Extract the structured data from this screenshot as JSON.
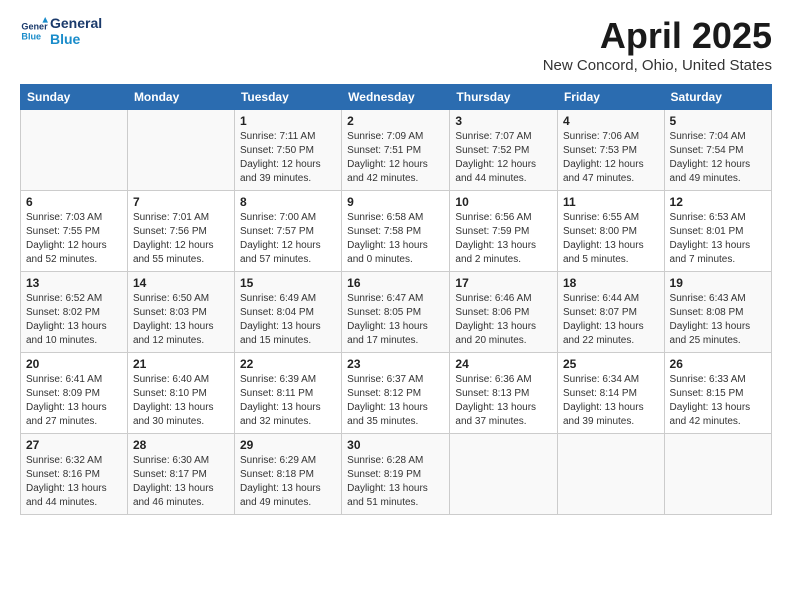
{
  "logo": {
    "line1": "General",
    "line2": "Blue"
  },
  "title": "April 2025",
  "location": "New Concord, Ohio, United States",
  "weekdays": [
    "Sunday",
    "Monday",
    "Tuesday",
    "Wednesday",
    "Thursday",
    "Friday",
    "Saturday"
  ],
  "weeks": [
    [
      {
        "day": "",
        "info": ""
      },
      {
        "day": "",
        "info": ""
      },
      {
        "day": "1",
        "info": "Sunrise: 7:11 AM\nSunset: 7:50 PM\nDaylight: 12 hours and 39 minutes."
      },
      {
        "day": "2",
        "info": "Sunrise: 7:09 AM\nSunset: 7:51 PM\nDaylight: 12 hours and 42 minutes."
      },
      {
        "day": "3",
        "info": "Sunrise: 7:07 AM\nSunset: 7:52 PM\nDaylight: 12 hours and 44 minutes."
      },
      {
        "day": "4",
        "info": "Sunrise: 7:06 AM\nSunset: 7:53 PM\nDaylight: 12 hours and 47 minutes."
      },
      {
        "day": "5",
        "info": "Sunrise: 7:04 AM\nSunset: 7:54 PM\nDaylight: 12 hours and 49 minutes."
      }
    ],
    [
      {
        "day": "6",
        "info": "Sunrise: 7:03 AM\nSunset: 7:55 PM\nDaylight: 12 hours and 52 minutes."
      },
      {
        "day": "7",
        "info": "Sunrise: 7:01 AM\nSunset: 7:56 PM\nDaylight: 12 hours and 55 minutes."
      },
      {
        "day": "8",
        "info": "Sunrise: 7:00 AM\nSunset: 7:57 PM\nDaylight: 12 hours and 57 minutes."
      },
      {
        "day": "9",
        "info": "Sunrise: 6:58 AM\nSunset: 7:58 PM\nDaylight: 13 hours and 0 minutes."
      },
      {
        "day": "10",
        "info": "Sunrise: 6:56 AM\nSunset: 7:59 PM\nDaylight: 13 hours and 2 minutes."
      },
      {
        "day": "11",
        "info": "Sunrise: 6:55 AM\nSunset: 8:00 PM\nDaylight: 13 hours and 5 minutes."
      },
      {
        "day": "12",
        "info": "Sunrise: 6:53 AM\nSunset: 8:01 PM\nDaylight: 13 hours and 7 minutes."
      }
    ],
    [
      {
        "day": "13",
        "info": "Sunrise: 6:52 AM\nSunset: 8:02 PM\nDaylight: 13 hours and 10 minutes."
      },
      {
        "day": "14",
        "info": "Sunrise: 6:50 AM\nSunset: 8:03 PM\nDaylight: 13 hours and 12 minutes."
      },
      {
        "day": "15",
        "info": "Sunrise: 6:49 AM\nSunset: 8:04 PM\nDaylight: 13 hours and 15 minutes."
      },
      {
        "day": "16",
        "info": "Sunrise: 6:47 AM\nSunset: 8:05 PM\nDaylight: 13 hours and 17 minutes."
      },
      {
        "day": "17",
        "info": "Sunrise: 6:46 AM\nSunset: 8:06 PM\nDaylight: 13 hours and 20 minutes."
      },
      {
        "day": "18",
        "info": "Sunrise: 6:44 AM\nSunset: 8:07 PM\nDaylight: 13 hours and 22 minutes."
      },
      {
        "day": "19",
        "info": "Sunrise: 6:43 AM\nSunset: 8:08 PM\nDaylight: 13 hours and 25 minutes."
      }
    ],
    [
      {
        "day": "20",
        "info": "Sunrise: 6:41 AM\nSunset: 8:09 PM\nDaylight: 13 hours and 27 minutes."
      },
      {
        "day": "21",
        "info": "Sunrise: 6:40 AM\nSunset: 8:10 PM\nDaylight: 13 hours and 30 minutes."
      },
      {
        "day": "22",
        "info": "Sunrise: 6:39 AM\nSunset: 8:11 PM\nDaylight: 13 hours and 32 minutes."
      },
      {
        "day": "23",
        "info": "Sunrise: 6:37 AM\nSunset: 8:12 PM\nDaylight: 13 hours and 35 minutes."
      },
      {
        "day": "24",
        "info": "Sunrise: 6:36 AM\nSunset: 8:13 PM\nDaylight: 13 hours and 37 minutes."
      },
      {
        "day": "25",
        "info": "Sunrise: 6:34 AM\nSunset: 8:14 PM\nDaylight: 13 hours and 39 minutes."
      },
      {
        "day": "26",
        "info": "Sunrise: 6:33 AM\nSunset: 8:15 PM\nDaylight: 13 hours and 42 minutes."
      }
    ],
    [
      {
        "day": "27",
        "info": "Sunrise: 6:32 AM\nSunset: 8:16 PM\nDaylight: 13 hours and 44 minutes."
      },
      {
        "day": "28",
        "info": "Sunrise: 6:30 AM\nSunset: 8:17 PM\nDaylight: 13 hours and 46 minutes."
      },
      {
        "day": "29",
        "info": "Sunrise: 6:29 AM\nSunset: 8:18 PM\nDaylight: 13 hours and 49 minutes."
      },
      {
        "day": "30",
        "info": "Sunrise: 6:28 AM\nSunset: 8:19 PM\nDaylight: 13 hours and 51 minutes."
      },
      {
        "day": "",
        "info": ""
      },
      {
        "day": "",
        "info": ""
      },
      {
        "day": "",
        "info": ""
      }
    ]
  ]
}
